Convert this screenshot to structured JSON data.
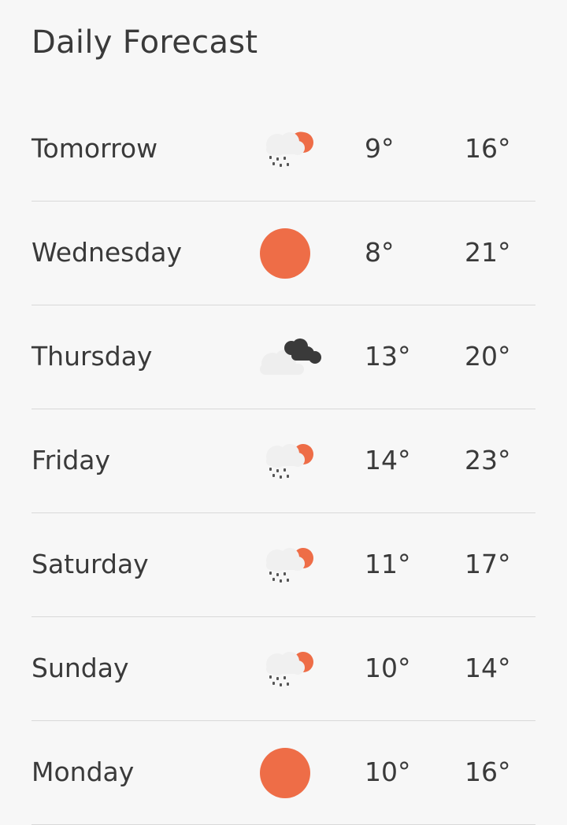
{
  "header": {
    "title": "Daily Forecast"
  },
  "colors": {
    "sun": "#ee6d47",
    "cloud_dark": "#3a3a3a",
    "cloud_light": "#eeeeee",
    "rain": "#555555"
  },
  "forecast": [
    {
      "day": "Tomorrow",
      "icon": "sun-cloud-rain-icon",
      "low": "9°",
      "high": "16°"
    },
    {
      "day": "Wednesday",
      "icon": "sun-icon",
      "low": "8°",
      "high": "21°"
    },
    {
      "day": "Thursday",
      "icon": "dark-cloud-icon",
      "low": "13°",
      "high": "20°"
    },
    {
      "day": "Friday",
      "icon": "sun-cloud-rain-icon",
      "low": "14°",
      "high": "23°"
    },
    {
      "day": "Saturday",
      "icon": "sun-cloud-rain-icon",
      "low": "11°",
      "high": "17°"
    },
    {
      "day": "Sunday",
      "icon": "sun-cloud-rain-icon",
      "low": "10°",
      "high": "14°"
    },
    {
      "day": "Monday",
      "icon": "sun-icon",
      "low": "10°",
      "high": "16°"
    }
  ]
}
